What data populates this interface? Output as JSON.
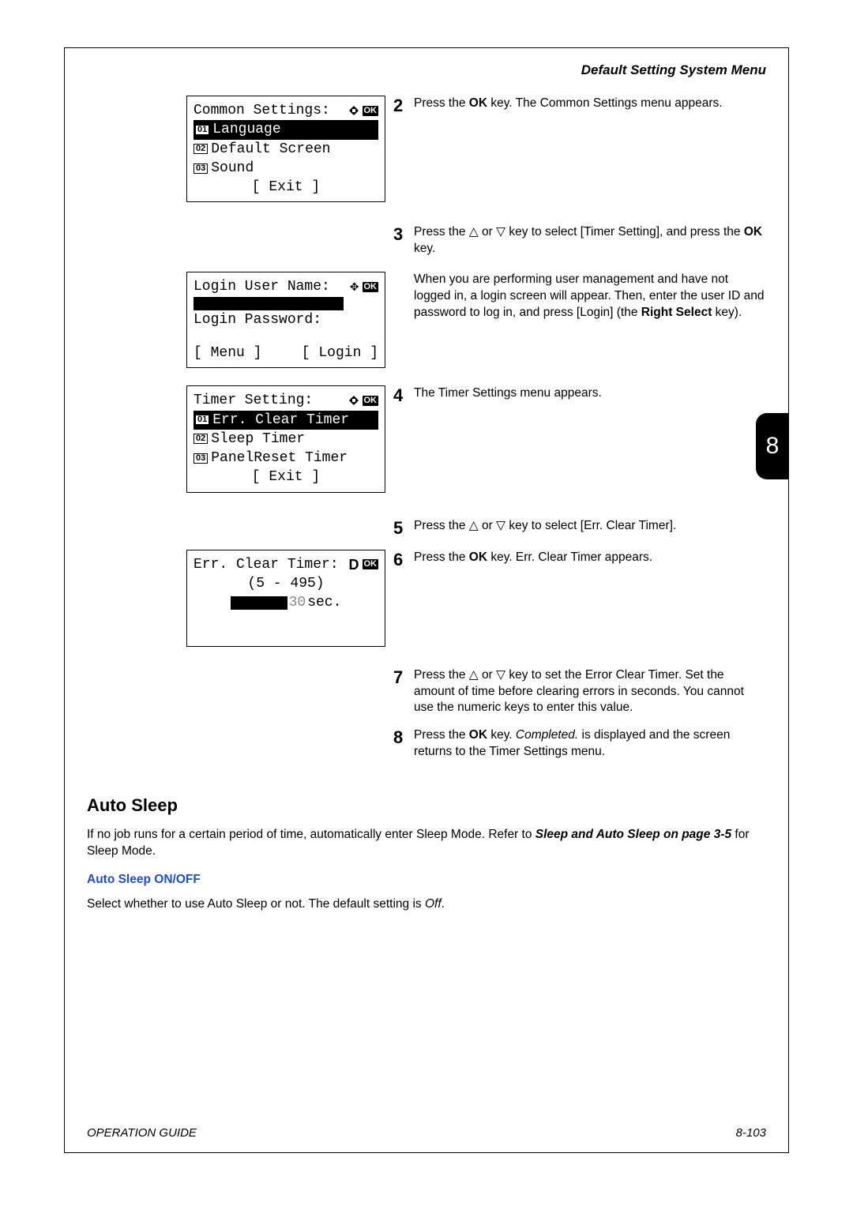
{
  "header": "Default Setting System Menu",
  "side_tab": "8",
  "lcd1": {
    "title": "Common Settings:",
    "items": [
      {
        "num": "01",
        "label": "Language",
        "selected": true
      },
      {
        "num": "02",
        "label": "Default Screen",
        "selected": false
      },
      {
        "num": "03",
        "label": "Sound",
        "selected": false
      }
    ],
    "footer": "[  Exit  ]"
  },
  "lcd2": {
    "title": "Login User Name:",
    "pw_label": "Login Password:",
    "menu_btn": "[ Menu  ]",
    "login_btn": "[ Login  ]"
  },
  "lcd3": {
    "title": "Timer Setting:",
    "items": [
      {
        "num": "01",
        "label": "Err. Clear Timer",
        "selected": true
      },
      {
        "num": "02",
        "label": "Sleep Timer",
        "selected": false
      },
      {
        "num": "03",
        "label": "PanelReset Timer",
        "selected": false
      }
    ],
    "footer": "[  Exit  ]"
  },
  "lcd4": {
    "title": "Err. Clear Timer:",
    "range": "(5 - 495)",
    "value": "30",
    "unit": "sec."
  },
  "steps": {
    "s2": {
      "num": "2",
      "pre": "Press the ",
      "ok": "OK",
      "post": " key. The Common Settings menu appears."
    },
    "s3": {
      "num": "3",
      "line1a": "Press the ",
      "line1b": " or ",
      "line1c": " key to select [Timer Setting], and press the ",
      "ok": "OK",
      "line1d": " key.",
      "para2": "When you are performing user management and have not logged in, a login screen will appear. Then, enter the user ID and password to log in, and press [Login] (the ",
      "rs": "Right Select",
      "para2b": " key)."
    },
    "s4": {
      "num": "4",
      "txt": "The Timer Settings menu appears."
    },
    "s5": {
      "num": "5",
      "a": "Press the ",
      "b": " or ",
      "c": " key to select [Err. Clear Timer]."
    },
    "s6": {
      "num": "6",
      "a": "Press the ",
      "ok": "OK",
      "b": " key. Err. Clear Timer appears."
    },
    "s7": {
      "num": "7",
      "a": "Press the ",
      "b": " or ",
      "c": " key to set the Error Clear Timer. Set the amount of time before clearing errors in seconds. You cannot use the numeric keys to enter this value."
    },
    "s8": {
      "num": "8",
      "a": "Press the ",
      "ok": "OK",
      "b": " key. ",
      "comp": "Completed.",
      "c": " is displayed and the screen returns to the Timer Settings menu."
    }
  },
  "section": {
    "title": "Auto Sleep",
    "body_a": "If no job runs for a certain period of time, automatically enter Sleep Mode. Refer to ",
    "body_ref": "Sleep and Auto Sleep on page 3-5",
    "body_b": " for Sleep Mode.",
    "sub": "Auto Sleep ON/OFF",
    "sub_body_a": "Select whether to use Auto Sleep or not. The default setting is ",
    "sub_off": "Off",
    "sub_body_b": "."
  },
  "footer": {
    "left": "OPERATION GUIDE",
    "right": "8-103"
  },
  "glyph": {
    "up": "△",
    "down": "▽",
    "ok": "OK"
  }
}
